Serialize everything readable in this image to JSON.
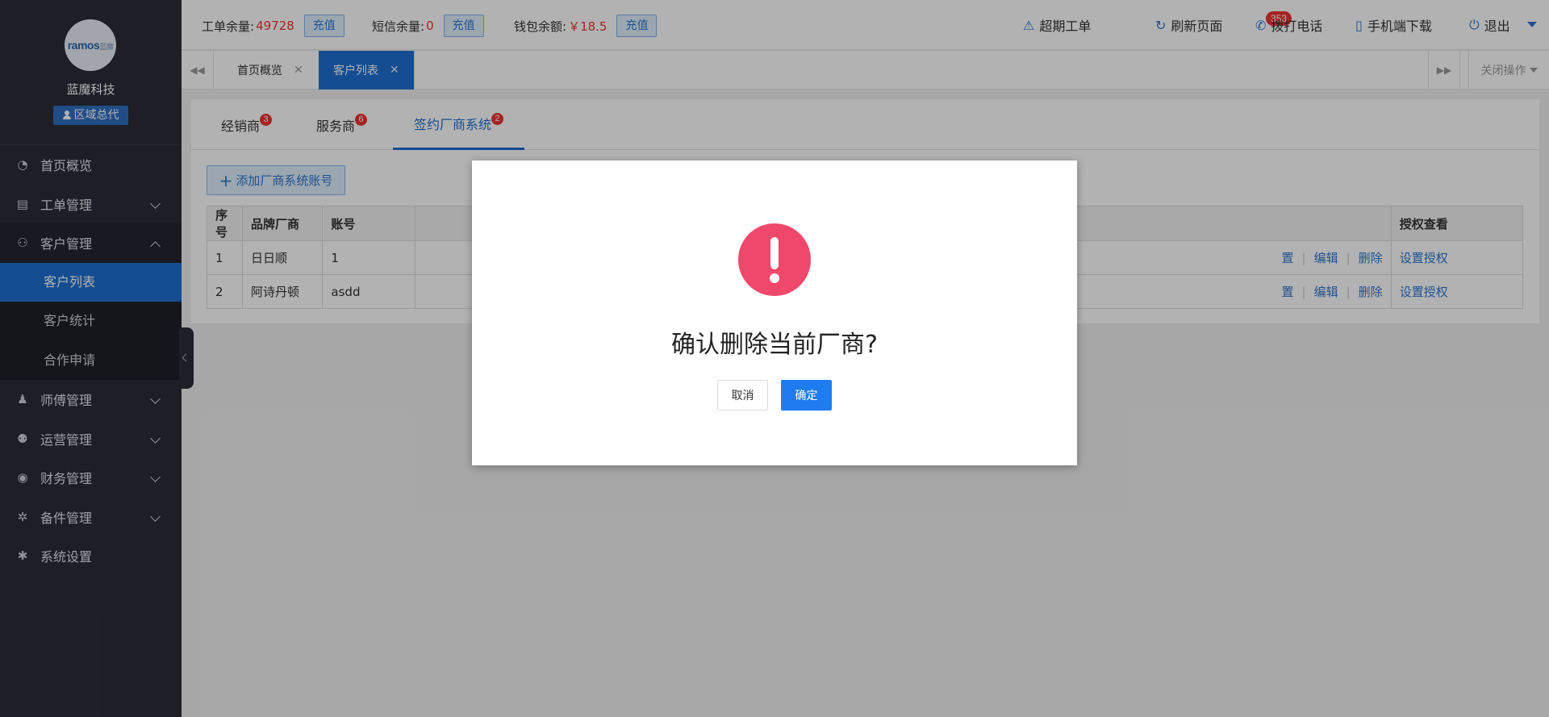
{
  "sidebar": {
    "logo_text": "ramos",
    "logo_sub": "蓝魔",
    "company": "蓝魔科技",
    "role": "区域总代",
    "menu": [
      {
        "label": "首页概览",
        "icon": "pie-chart-icon"
      },
      {
        "label": "工单管理",
        "icon": "clipboard-icon"
      },
      {
        "label": "客户管理",
        "icon": "users-icon"
      },
      {
        "label": "师傅管理",
        "icon": "user-icon"
      },
      {
        "label": "运营管理",
        "icon": "group-icon"
      },
      {
        "label": "财务管理",
        "icon": "yuan-coin-icon"
      },
      {
        "label": "备件管理",
        "icon": "gears-icon"
      },
      {
        "label": "系统设置",
        "icon": "gear-icon"
      }
    ],
    "submenu": [
      "客户列表",
      "客户统计",
      "合作申请"
    ]
  },
  "topbar": {
    "workorder_label": "工单余量:",
    "workorder_value": "49728",
    "sms_label": "短信余量:",
    "sms_value": "0",
    "wallet_label": "钱包余额:",
    "wallet_value": "￥18.5",
    "charge": "充值",
    "overdue_label": "超期工单",
    "overdue_count": "353",
    "refresh": "刷新页面",
    "call": "拨打电话",
    "mobile_download": "手机端下载",
    "logout": "退出"
  },
  "tabs": {
    "items": [
      "首页概览",
      "客户列表"
    ],
    "close_ops": "关闭操作"
  },
  "panel": {
    "sub_tabs": [
      {
        "label": "经销商",
        "count": "3"
      },
      {
        "label": "服务商",
        "count": "6"
      },
      {
        "label": "签约厂商系统",
        "count": "2"
      }
    ],
    "add_button": "添加厂商系统账号",
    "table": {
      "headers": [
        "序号",
        "品牌厂商",
        "账号",
        "授权查看"
      ],
      "rows": [
        {
          "no": "1",
          "brand": "日日顺",
          "account": "1",
          "op_partial": "置",
          "edit": "编辑",
          "delete": "删除",
          "auth": "设置授权"
        },
        {
          "no": "2",
          "brand": "阿诗丹顿",
          "account": "asdd",
          "op_partial": "置",
          "edit": "编辑",
          "delete": "删除",
          "auth": "设置授权"
        }
      ]
    }
  },
  "dialog": {
    "message": "确认删除当前厂商?",
    "cancel": "取消",
    "confirm": "确定"
  }
}
